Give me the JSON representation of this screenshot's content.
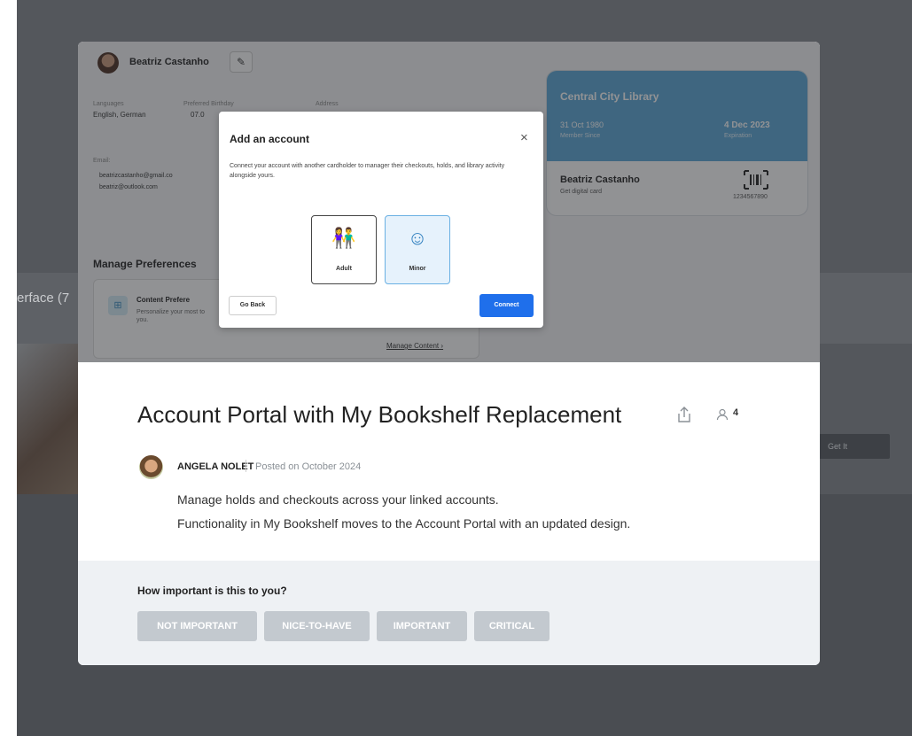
{
  "background": {
    "left_text": "erface (7",
    "button_label": "Get It"
  },
  "preview": {
    "profile": {
      "name": "Beatriz Castanho",
      "languages_label": "Languages",
      "languages_value": "English, German",
      "birthday_label": "Preferred Birthday",
      "birthday_value": "07.0",
      "address_label": "Address",
      "email_label": "Email:",
      "email_1": "beatrizcastanho@gmail.co",
      "email_2": "beatriz@outlook.com"
    },
    "library_card": {
      "title": "Central City Library",
      "member_since_date": "31 Oct 1980",
      "member_since_label": "Member Since",
      "expiration_date": "4 Dec 2023",
      "expiration_label": "Expiration",
      "holder_name": "Beatriz Castanho",
      "digital_card": "Get digital card",
      "card_number": "1234567890"
    },
    "manage_preferences": {
      "title": "Manage Preferences",
      "card_title": "Content Prefere",
      "card_text": "Personalize your most to you.",
      "card_link": "Manage Content ›"
    },
    "dialog": {
      "title": "Add an account",
      "close": "×",
      "text": "Connect your account with another cardholder to manager their checkouts, holds, and library activity alongside yours.",
      "option_adult": "Adult",
      "option_minor": "Minor",
      "back_button": "Go Back",
      "connect_button": "Connect"
    }
  },
  "post": {
    "title": "Account Portal with My Bookshelf Replacement",
    "follower_count": "4",
    "author": "ANGELA NOLET",
    "posted": "Posted on October 2024",
    "line1": "Manage holds and checkouts across your linked accounts.",
    "line2": "Functionality in My Bookshelf moves to the Account Portal with an updated design."
  },
  "rating": {
    "question": "How important is this to you?",
    "options": [
      "NOT IMPORTANT",
      "NICE-TO-HAVE",
      "IMPORTANT",
      "CRITICAL"
    ]
  },
  "colors": {
    "backdrop": "#54575c",
    "card_blue": "#5aa7d6",
    "connect_blue": "#1f6feb",
    "rating_button": "#c3c9cf",
    "rating_bg": "#eef1f4"
  },
  "icons": [
    "edit-icon",
    "close-icon",
    "adult-icon",
    "minor-icon",
    "share-icon",
    "person-icon",
    "barcode-icon",
    "grid-icon"
  ]
}
